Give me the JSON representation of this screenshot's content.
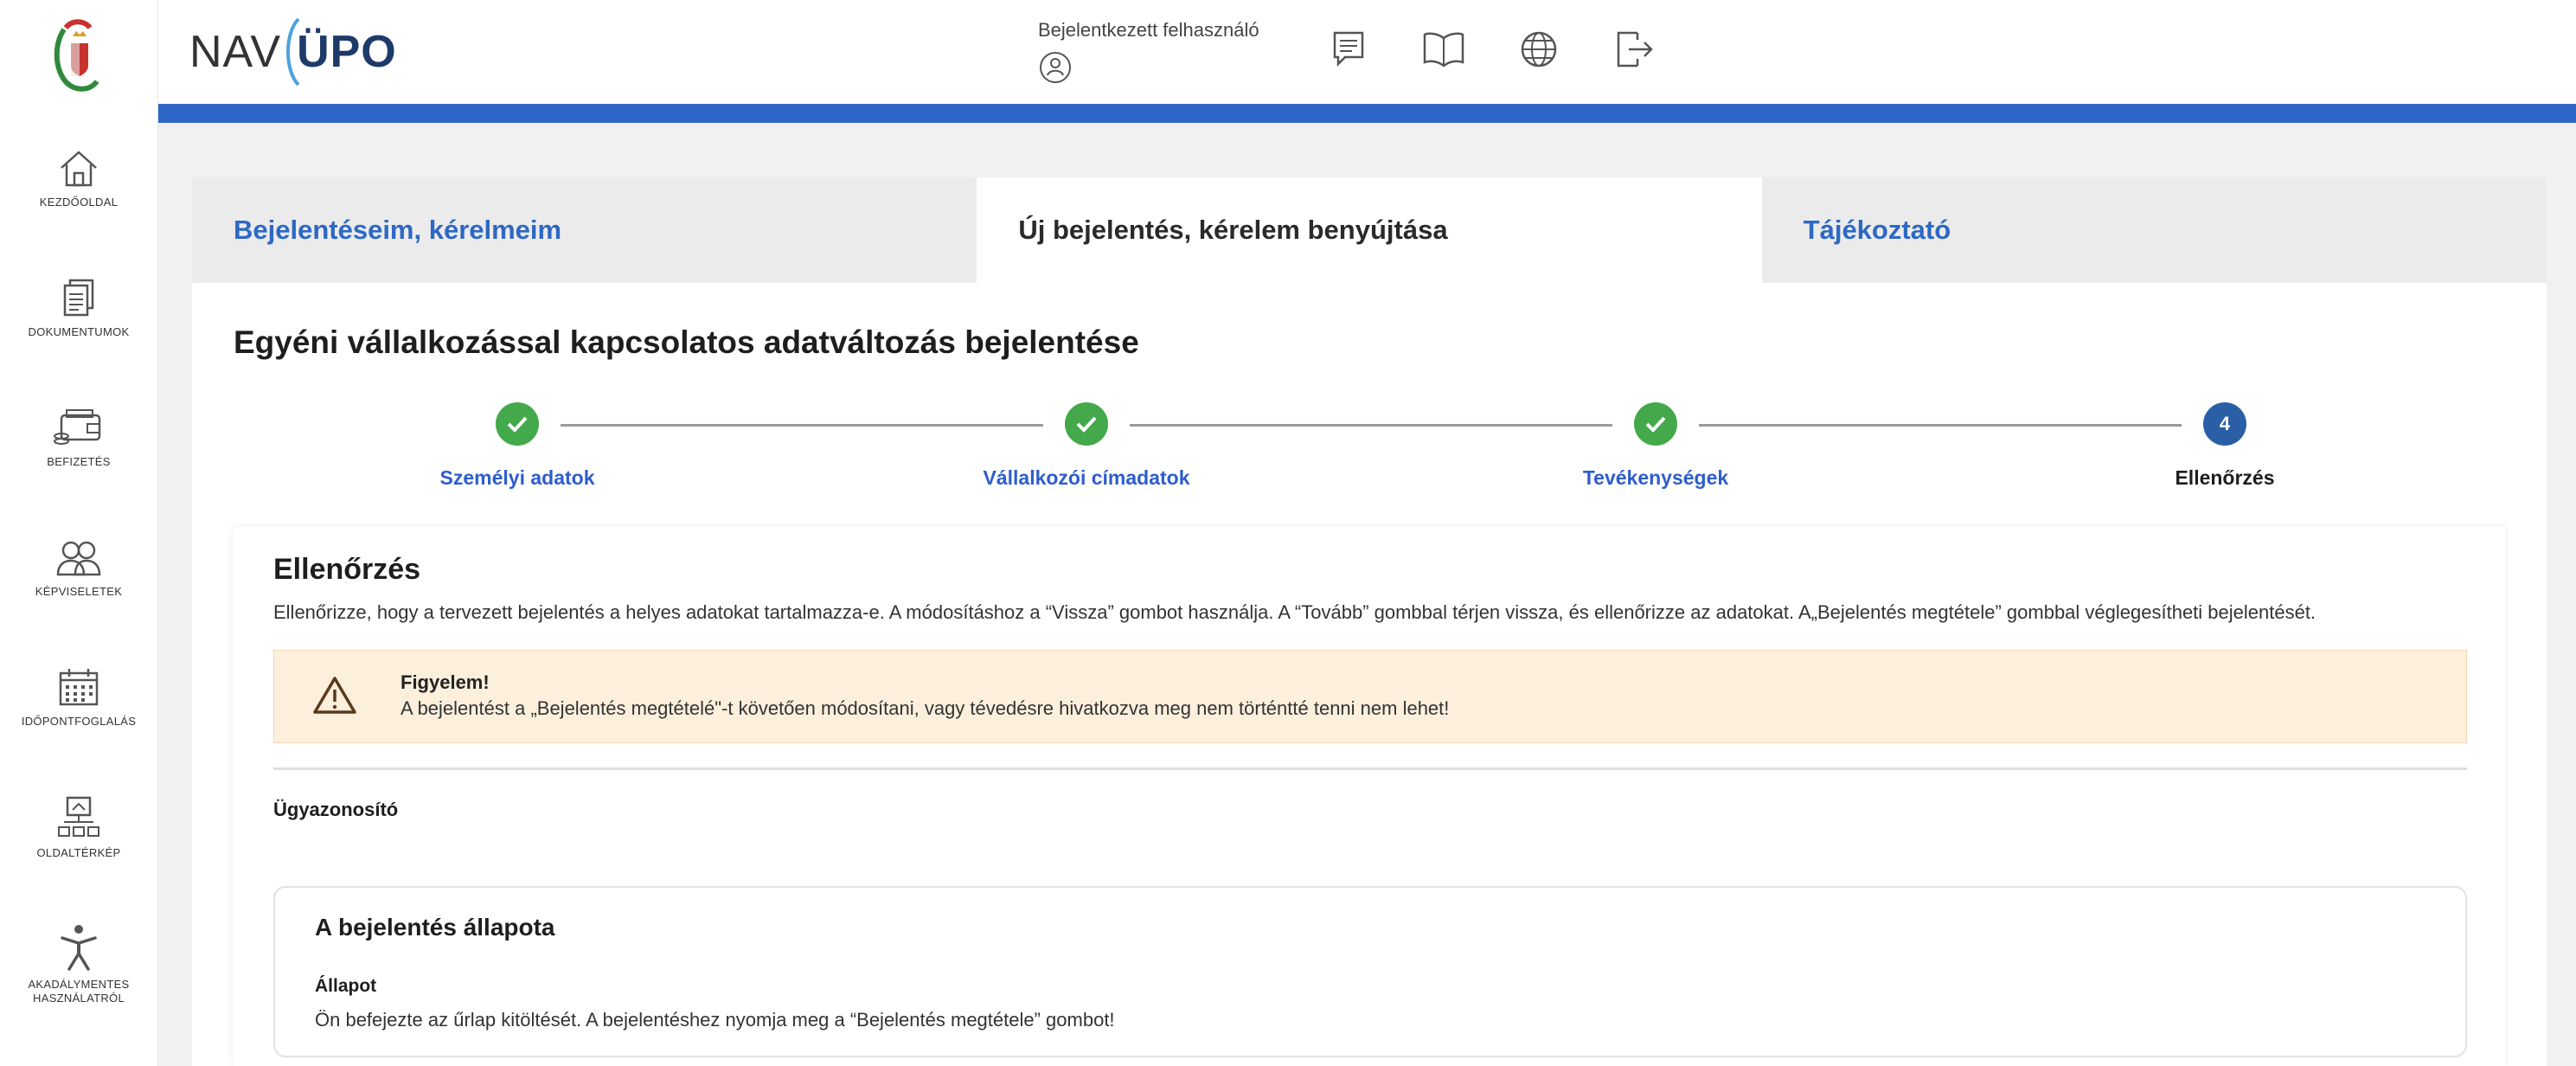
{
  "sidebar": {
    "items": [
      {
        "label": "KEZDŐOLDAL",
        "icon": "home-icon"
      },
      {
        "label": "DOKUMENTUMOK",
        "icon": "documents-icon"
      },
      {
        "label": "BEFIZETÉS",
        "icon": "wallet-icon"
      },
      {
        "label": "KÉPVISELETEK",
        "icon": "people-icon"
      },
      {
        "label": "IDŐPONTFOGLALÁS",
        "icon": "calendar-icon"
      },
      {
        "label": "OLDALTÉRKÉP",
        "icon": "sitemap-icon"
      },
      {
        "label_line1": "AKADÁLYMENTES",
        "label_line2": "HASZNÁLATRÓL",
        "icon": "accessibility-icon"
      }
    ]
  },
  "header": {
    "logo_nav": "NAV",
    "logo_upo": "ÜPO",
    "user_label": "Bejelentkezett felhasználó",
    "icons": [
      "user-icon",
      "messages-icon",
      "manual-icon",
      "language-icon",
      "logout-icon"
    ],
    "accent_color": "#2f67c9"
  },
  "tabs": [
    {
      "label": "Bejelentéseim, kérelmeim",
      "active": false
    },
    {
      "label": "Új bejelentés, kérelem benyújtása",
      "active": true
    },
    {
      "label": "Tájékoztató",
      "active": false
    }
  ],
  "page": {
    "title": "Egyéni vállalkozással kapcsolatos adatváltozás bejelentése"
  },
  "stepper": {
    "steps": [
      {
        "label": "Személyi adatok",
        "status": "done"
      },
      {
        "label": "Vállalkozói címadatok",
        "status": "done"
      },
      {
        "label": "Tevékenységek",
        "status": "done"
      },
      {
        "label": "Ellenőrzés",
        "status": "current",
        "number": "4"
      }
    ]
  },
  "review": {
    "title": "Ellenőrzés",
    "description": "Ellenőrizze, hogy a tervezett bejelentés a helyes adatokat tartalmazza-e. A módosításhoz a “Vissza” gombot használja. A “Tovább” gombbal térjen vissza, és ellenőrizze az adatokat. A„Bejelentés megtétele” gombbal véglegesítheti bejelentését.",
    "warning": {
      "title": "Figyelem!",
      "text": "A bejelentést a „Bejelentés megtételé\"-t követően módosítani, vagy tévedésre hivatkozva meg nem történtté tenni nem lehet!"
    },
    "case_id_label": "Ügyazonosító",
    "status_box": {
      "title": "A bejelentés állapota",
      "label": "Állapot",
      "text": "Ön befejezte az űrlap kitöltését. A bejelentéshez nyomja meg a “Bejelentés megtétele” gombot!"
    }
  }
}
